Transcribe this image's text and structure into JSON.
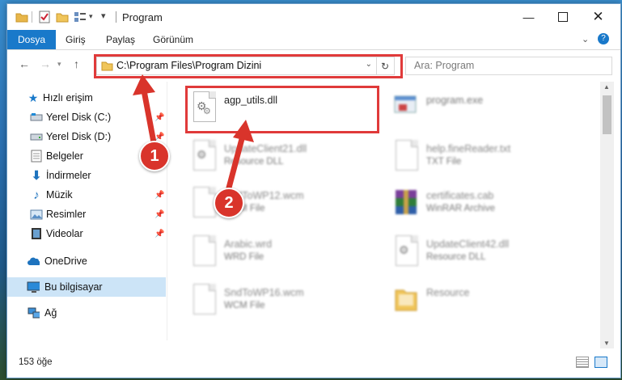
{
  "window": {
    "title": "Program"
  },
  "ribbon": {
    "tabs": [
      "Dosya",
      "Giriş",
      "Paylaş",
      "Görünüm"
    ]
  },
  "nav": {
    "address": "C:\\Program Files\\Program Dizini",
    "search_placeholder": "Ara: Program"
  },
  "sidebar": {
    "quick_access": "Hızlı erişim",
    "items": [
      "Yerel Disk (C:)",
      "Yerel Disk (D:)",
      "Belgeler",
      "İndirmeler",
      "Müzik",
      "Resimler",
      "Videolar"
    ],
    "onedrive": "OneDrive",
    "this_pc": "Bu bilgisayar",
    "network": "Ağ"
  },
  "files": [
    {
      "name": "agp_utils.dll",
      "type": "",
      "icon": "dll-gear-icon"
    },
    {
      "name": "program.exe",
      "type": "",
      "icon": "exe-icon"
    },
    {
      "name": "UpdateClient21.dll",
      "type": "Resource DLL",
      "icon": "dll-gear-icon"
    },
    {
      "name": "help.fineReader.txt",
      "type": "TXT File",
      "icon": "text-file-icon"
    },
    {
      "name": "SndToWP12.wcm",
      "type": "WCM File",
      "icon": "generic-file-icon"
    },
    {
      "name": "certificates.cab",
      "type": "WinRAR Archive",
      "icon": "winrar-icon"
    },
    {
      "name": "Arabic.wrd",
      "type": "WRD File",
      "icon": "generic-file-icon"
    },
    {
      "name": "UpdateClient42.dll",
      "type": "Resource DLL",
      "icon": "dll-gear-icon"
    },
    {
      "name": "SndToWP16.wcm",
      "type": "WCM File",
      "icon": "generic-file-icon"
    },
    {
      "name": "Resource",
      "type": "",
      "icon": "folder-icon"
    }
  ],
  "status": {
    "count": "153 öğe"
  },
  "callouts": [
    "1",
    "2"
  ],
  "colors": {
    "accent": "#1979ca",
    "highlight": "#e03a3a",
    "selection": "#cce4f7"
  }
}
